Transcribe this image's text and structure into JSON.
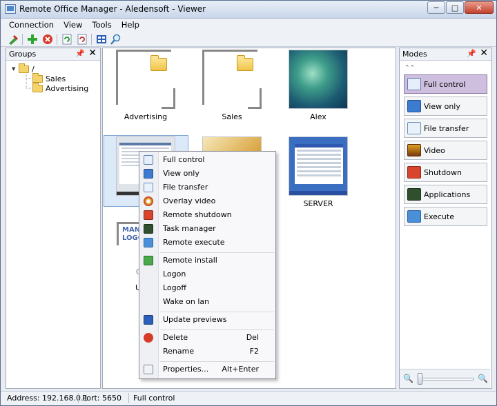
{
  "window": {
    "title": "Remote Office Manager - Aledensoft - Viewer",
    "min_label": "─",
    "max_label": "□",
    "close_label": "✕"
  },
  "menu": {
    "connection": "Connection",
    "view": "View",
    "tools": "Tools",
    "help": "Help"
  },
  "toolbar_icons": [
    "connect-icon",
    "add-icon",
    "delete-icon",
    "refresh-icon",
    "refresh-all-icon",
    "grid-view-icon",
    "search-icon"
  ],
  "groups_panel": {
    "title": "Groups",
    "pin": "📌",
    "close": "✕",
    "tree": {
      "root": "/",
      "children": [
        "Sales",
        "Advertising"
      ]
    }
  },
  "main": {
    "tiles": {
      "advertising": "Advertising",
      "sales": "Sales",
      "alex": "Alex",
      "server": "SERVER",
      "logo_line1": "MANU",
      "logo_line2": "LOGO",
      "partial_c": "C",
      "partial_u": "U"
    }
  },
  "context_menu": {
    "full_control": "Full control",
    "view_only": "View only",
    "file_transfer": "File transfer",
    "overlay_video": "Overlay video",
    "remote_shutdown": "Remote shutdown",
    "task_manager": "Task manager",
    "remote_execute": "Remote execute",
    "remote_install": "Remote install",
    "logon": "Logon",
    "logoff": "Logoff",
    "wake_on_lan": "Wake on lan",
    "update_previews": "Update previews",
    "delete": "Delete",
    "delete_key": "Del",
    "rename": "Rename",
    "rename_key": "F2",
    "properties": "Properties...",
    "properties_key": "Alt+Enter"
  },
  "modes_panel": {
    "title": "Modes",
    "pin": "📌",
    "close": "✕",
    "scroll_up": "⌃⌃",
    "full_control": "Full control",
    "view_only": "View only",
    "file_transfer": "File transfer",
    "video": "Video",
    "shutdown": "Shutdown",
    "applications": "Applications",
    "execute": "Execute",
    "zoom_out": "🔍",
    "zoom_in": "🔍"
  },
  "status": {
    "address": "Address: 192.168.0.1",
    "port": "Port: 5650",
    "mode": "Full control"
  },
  "colors": {
    "active_mode": "#cdbfdd",
    "selection": "#dce9f8",
    "folder": "#f5d36c"
  }
}
